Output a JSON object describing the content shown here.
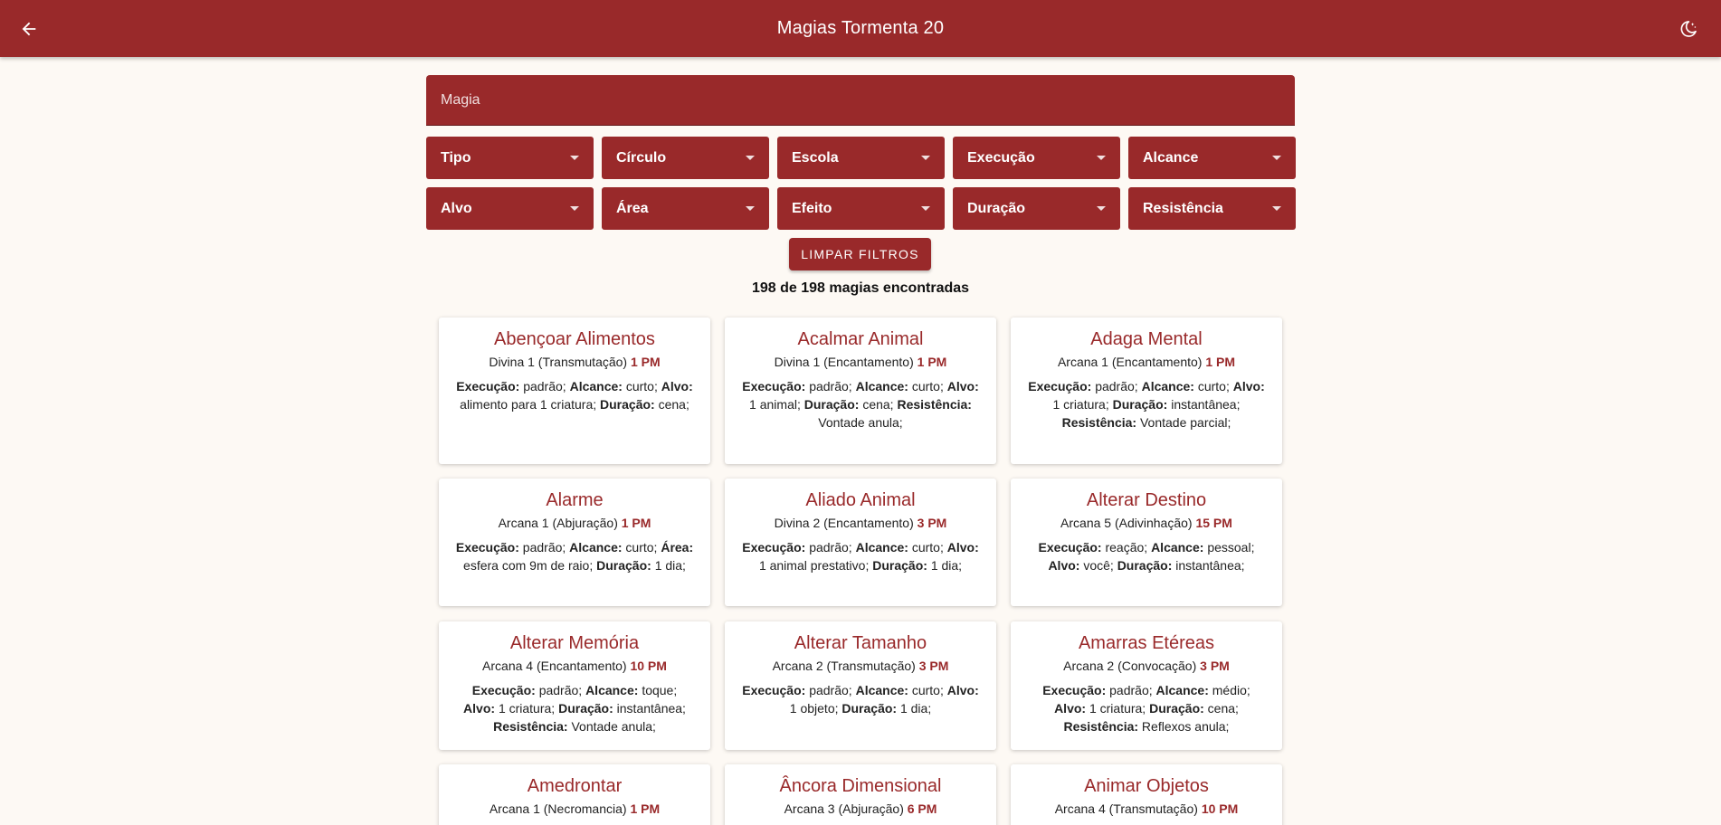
{
  "header": {
    "title": "Magias Tormenta 20",
    "back_icon": "arrow-left-icon",
    "theme_icon": "moon-icon"
  },
  "search": {
    "placeholder": "Magia",
    "value": ""
  },
  "filters": [
    "Tipo",
    "Círculo",
    "Escola",
    "Execução",
    "Alcance",
    "Alvo",
    "Área",
    "Efeito",
    "Duração",
    "Resistência"
  ],
  "clear_button": "LIMPAR FILTROS",
  "result_count": "198 de 198 magias encontradas",
  "colors": {
    "primary": "#99292a",
    "background": "#fdf9f4"
  },
  "cards": [
    {
      "name": "Abençoar Alimentos",
      "meta": "Divina 1 (Transmutação)",
      "pm": "1 PM",
      "details": [
        [
          "Execução:",
          "padrão;"
        ],
        [
          "Alcance:",
          "curto;"
        ],
        [
          "Alvo:",
          "alimento para 1 criatura;"
        ],
        [
          "Duração:",
          "cena;"
        ]
      ]
    },
    {
      "name": "Acalmar Animal",
      "meta": "Divina 1 (Encantamento)",
      "pm": "1 PM",
      "details": [
        [
          "Execução:",
          "padrão;"
        ],
        [
          "Alcance:",
          "curto;"
        ],
        [
          "Alvo:",
          "1 animal;"
        ],
        [
          "Duração:",
          "cena;"
        ],
        [
          "Resistência:",
          "Vontade anula;"
        ]
      ]
    },
    {
      "name": "Adaga Mental",
      "meta": "Arcana 1 (Encantamento)",
      "pm": "1 PM",
      "details": [
        [
          "Execução:",
          "padrão;"
        ],
        [
          "Alcance:",
          "curto;"
        ],
        [
          "Alvo:",
          "1 criatura;"
        ],
        [
          "Duração:",
          "instantânea;"
        ],
        [
          "Resistência:",
          "Vontade parcial;"
        ]
      ]
    },
    {
      "name": "Alarme",
      "meta": "Arcana 1 (Abjuração)",
      "pm": "1 PM",
      "details": [
        [
          "Execução:",
          "padrão;"
        ],
        [
          "Alcance:",
          "curto;"
        ],
        [
          "Área:",
          "esfera com 9m de raio;"
        ],
        [
          "Duração:",
          "1 dia;"
        ]
      ]
    },
    {
      "name": "Aliado Animal",
      "meta": "Divina 2 (Encantamento)",
      "pm": "3 PM",
      "details": [
        [
          "Execução:",
          "padrão;"
        ],
        [
          "Alcance:",
          "curto;"
        ],
        [
          "Alvo:",
          "1 animal prestativo;"
        ],
        [
          "Duração:",
          "1 dia;"
        ]
      ]
    },
    {
      "name": "Alterar Destino",
      "meta": "Arcana 5 (Adivinhação)",
      "pm": "15 PM",
      "details": [
        [
          "Execução:",
          "reação;"
        ],
        [
          "Alcance:",
          "pessoal;"
        ],
        [
          "Alvo:",
          "você;"
        ],
        [
          "Duração:",
          "instantânea;"
        ]
      ]
    },
    {
      "name": "Alterar Memória",
      "meta": "Arcana 4 (Encantamento)",
      "pm": "10 PM",
      "details": [
        [
          "Execução:",
          "padrão;"
        ],
        [
          "Alcance:",
          "toque;"
        ],
        [
          "Alvo:",
          "1 criatura;"
        ],
        [
          "Duração:",
          "instantânea;"
        ],
        [
          "Resistência:",
          "Vontade anula;"
        ]
      ]
    },
    {
      "name": "Alterar Tamanho",
      "meta": "Arcana 2 (Transmutação)",
      "pm": "3 PM",
      "details": [
        [
          "Execução:",
          "padrão;"
        ],
        [
          "Alcance:",
          "curto;"
        ],
        [
          "Alvo:",
          "1 objeto;"
        ],
        [
          "Duração:",
          "1 dia;"
        ]
      ]
    },
    {
      "name": "Amarras Etéreas",
      "meta": "Arcana 2 (Convocação)",
      "pm": "3 PM",
      "details": [
        [
          "Execução:",
          "padrão;"
        ],
        [
          "Alcance:",
          "médio;"
        ],
        [
          "Alvo:",
          "1 criatura;"
        ],
        [
          "Duração:",
          "cena;"
        ],
        [
          "Resistência:",
          "Reflexos anula;"
        ]
      ]
    },
    {
      "name": "Amedrontar",
      "meta": "Arcana 1 (Necromancia)",
      "pm": "1 PM",
      "details": []
    },
    {
      "name": "Âncora Dimensional",
      "meta": "Arcana 3 (Abjuração)",
      "pm": "6 PM",
      "details": []
    },
    {
      "name": "Animar Objetos",
      "meta": "Arcana 4 (Transmutação)",
      "pm": "10 PM",
      "details": []
    }
  ]
}
